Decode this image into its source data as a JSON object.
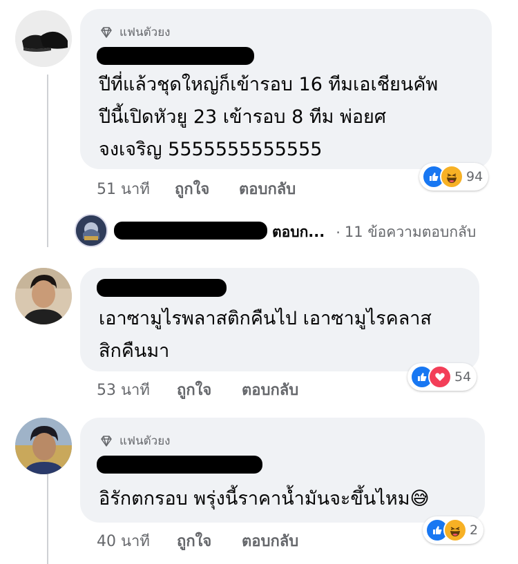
{
  "colors": {
    "like": "#1877f2",
    "haha": "#f7b125",
    "love": "#f33e58",
    "bubble": "#f0f2f5",
    "meta": "#65676b"
  },
  "comments": [
    {
      "badge": "แฟนตัวยง",
      "lines": [
        "ปีที่แล้วชุดใหญ่ก็เข้ารอบ 16 ทีมเอเชียนคัพ",
        "ปีนี้เปิดหัวยู 23 เข้ารอบ 8 ทีม พ่อยศ",
        "จงเจริญ 5555555555555"
      ],
      "time": "51 นาที",
      "like_label": "ถูกใจ",
      "reply_label": "ตอบกลับ",
      "reactions": [
        "like-icon",
        "haha-icon"
      ],
      "reaction_count": "94"
    },
    {
      "badge": "",
      "lines": [
        "เอาซามูไรพลาสติกคืนไป เอาซามูไรคลาส",
        "สิกคืนมา"
      ],
      "time": "53 นาที",
      "like_label": "ถูกใจ",
      "reply_label": "ตอบกลับ",
      "reactions": [
        "like-icon",
        "love-icon"
      ],
      "reaction_count": "54"
    },
    {
      "badge": "แฟนตัวยง",
      "lines": [
        "อิรักตกรอบ พรุ่งนี้ราคาน้ำมันจะขึ้นไหม"
      ],
      "emoji": "😅",
      "time": "40 นาที",
      "like_label": "ถูกใจ",
      "reply_label": "ตอบกลับ",
      "reactions": [
        "like-icon",
        "haha-icon"
      ],
      "reaction_count": "2"
    }
  ],
  "reply_summary": {
    "name_suffix": "ตอบก...",
    "separator": "·",
    "text": "11 ข้อความตอบกลับ"
  }
}
